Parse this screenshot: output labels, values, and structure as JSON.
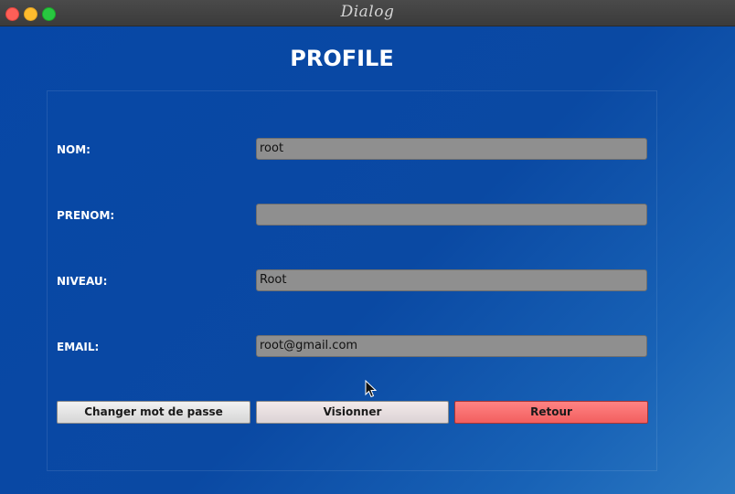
{
  "window": {
    "title": "Dialog",
    "controls": {
      "close": "close-icon",
      "minimize": "minimize-icon",
      "maximize": "maximize-icon"
    }
  },
  "page": {
    "title": "PROFILE"
  },
  "form": {
    "nom": {
      "label": "NOM:",
      "value": "root"
    },
    "prenom": {
      "label": "PRENOM:",
      "value": ""
    },
    "niveau": {
      "label": "NIVEAU:",
      "value": "Root"
    },
    "email": {
      "label": "EMAIL:",
      "value": "root@gmail.com"
    }
  },
  "buttons": {
    "change_password": "Changer mot de passe",
    "view": "Visionner",
    "back": "Retour"
  },
  "colors": {
    "background": "#0747a6",
    "input_background": "#8f8f8f",
    "back_button": "#f46a6a"
  }
}
